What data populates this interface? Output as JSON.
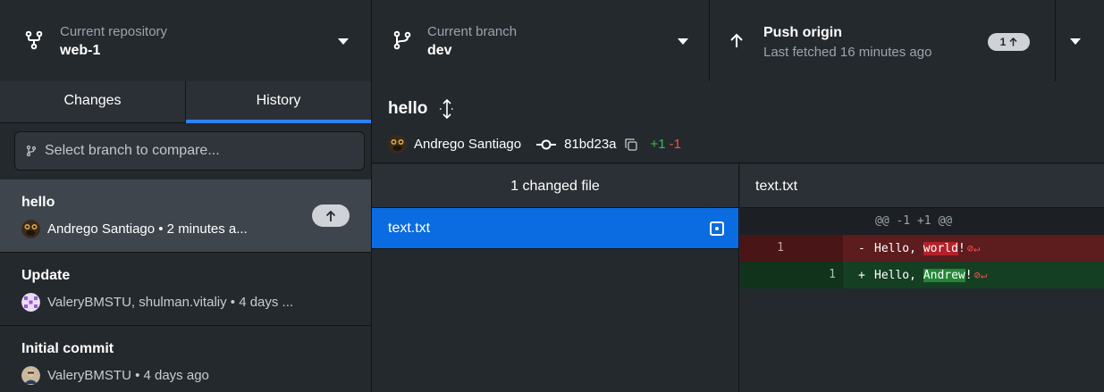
{
  "toolbar": {
    "repo": {
      "label": "Current repository",
      "value": "web-1"
    },
    "branch": {
      "label": "Current branch",
      "value": "dev"
    },
    "push": {
      "label": "Push origin",
      "sub": "Last fetched 16 minutes ago",
      "badge_count": "1"
    }
  },
  "tabs": [
    {
      "label": "Changes",
      "active": false
    },
    {
      "label": "History",
      "active": true
    }
  ],
  "compare": {
    "placeholder": "Select branch to compare..."
  },
  "commits": [
    {
      "title": "hello",
      "meta": "Andrego Santiago • 2 minutes a...",
      "selected": true,
      "unpushed": true
    },
    {
      "title": "Update",
      "meta": "ValeryBMSTU, shulman.vitaliy • 4 days ...",
      "selected": false
    },
    {
      "title": "Initial commit",
      "meta": "ValeryBMSTU • 4 days ago",
      "selected": false
    }
  ],
  "commit_detail": {
    "title": "hello",
    "author": "Andrego Santiago",
    "sha": "81bd23a",
    "additions": "+1",
    "deletions": "-1"
  },
  "files": {
    "header": "1 changed file",
    "items": [
      {
        "name": "text.txt",
        "status": "modified"
      }
    ]
  },
  "diff": {
    "file": "text.txt",
    "hunk": "@@ -1 +1 @@",
    "removed": {
      "line": "1",
      "sign": "-",
      "prefix": "Hello, ",
      "changed": "world",
      "suffix": "!"
    },
    "added": {
      "line": "1",
      "sign": "+",
      "prefix": "Hello, ",
      "changed": "Andrew",
      "suffix": "!"
    }
  },
  "colors": {
    "accent": "#0a6ce0",
    "tab_underline": "#2f81f7",
    "add": "#3fb950",
    "del": "#f85149"
  }
}
